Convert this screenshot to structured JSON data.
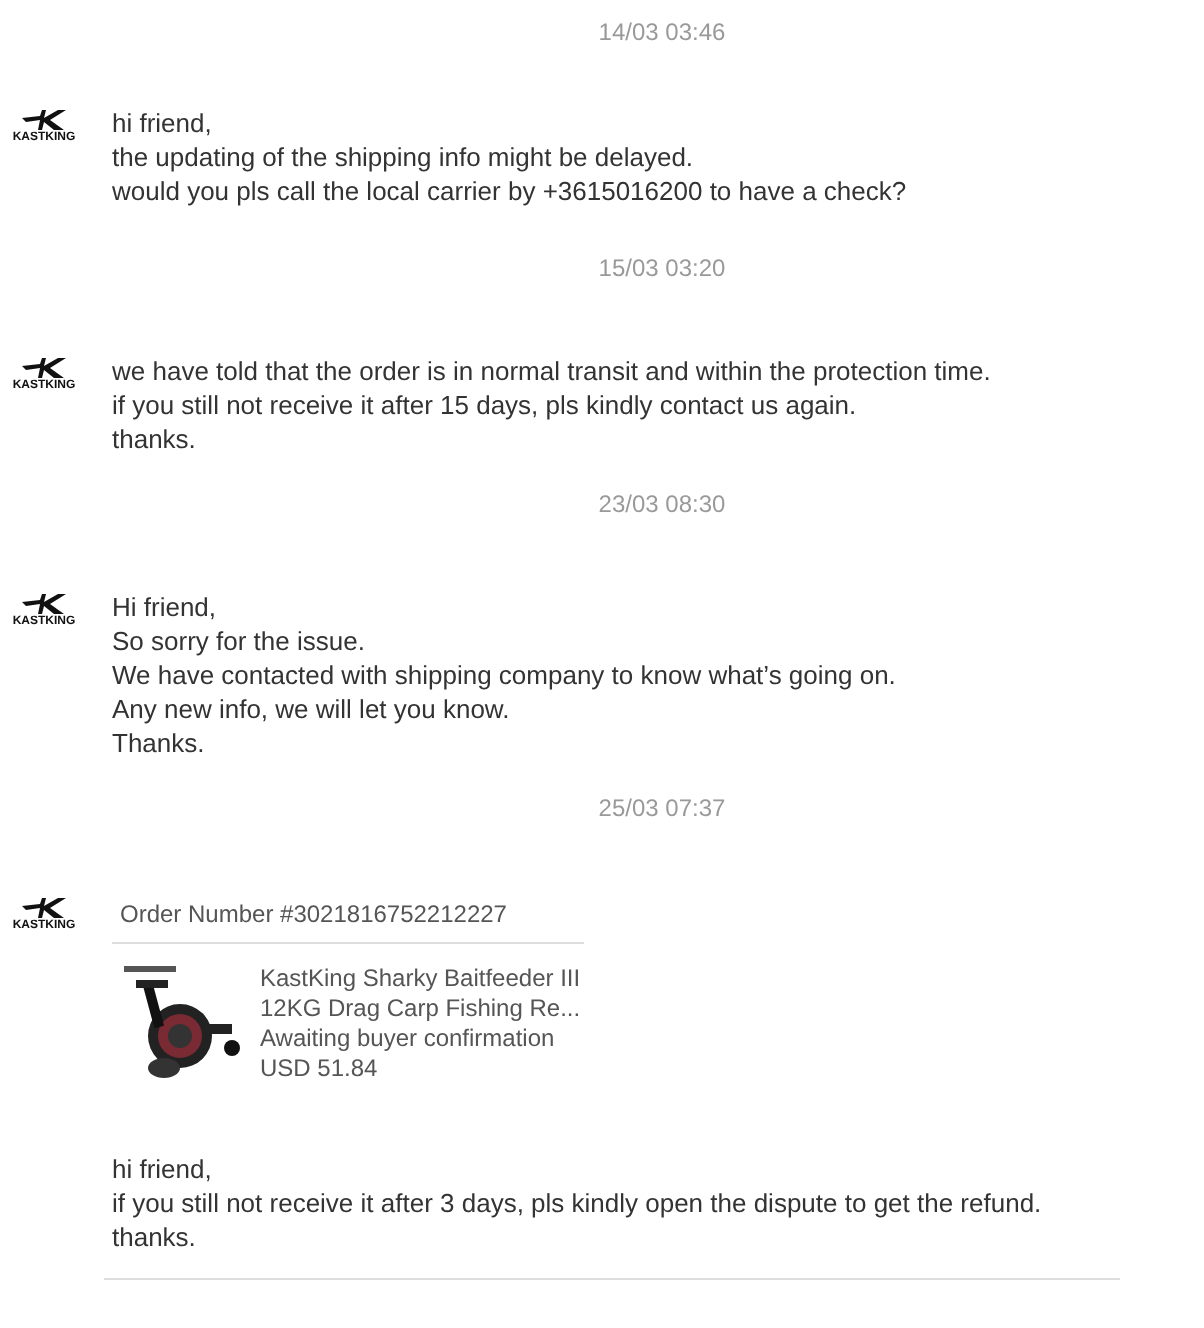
{
  "messages": [
    {
      "time": "14/03 03:46",
      "brand": "KASTKING",
      "kind": "text",
      "lines": [
        "hi friend,",
        "the updating of the shipping info might be delayed.",
        "would you pls call the local carrier by +3615016200 to have a check?"
      ]
    },
    {
      "time": "15/03 03:20",
      "brand": "KASTKING",
      "kind": "text",
      "lines": [
        "we have told that the order is in normal transit and within the protection time.",
        "if you still not receive it after 15 days, pls kindly contact us again.",
        "thanks."
      ]
    },
    {
      "time": "23/03 08:30",
      "brand": "KASTKING",
      "kind": "text",
      "lines": [
        "Hi friend,",
        "So sorry for the issue.",
        "We have contacted with shipping company to know what’s going on.",
        "Any new info, we will let you know.",
        "Thanks."
      ]
    },
    {
      "time": "25/03 07:37",
      "brand": "KASTKING",
      "kind": "order",
      "order": {
        "number": "Order Number #3021816752212227",
        "title_lines": [
          "KastKing Sharky Baitfeeder III",
          "12KG Drag Carp Fishing Re..."
        ],
        "status": "Awaiting buyer confirmation",
        "price": "USD 51.84"
      },
      "lines": [
        "hi friend,",
        "if you still not receive it after 3 days, pls kindly open the dispute to get the refund.",
        "thanks."
      ]
    }
  ]
}
